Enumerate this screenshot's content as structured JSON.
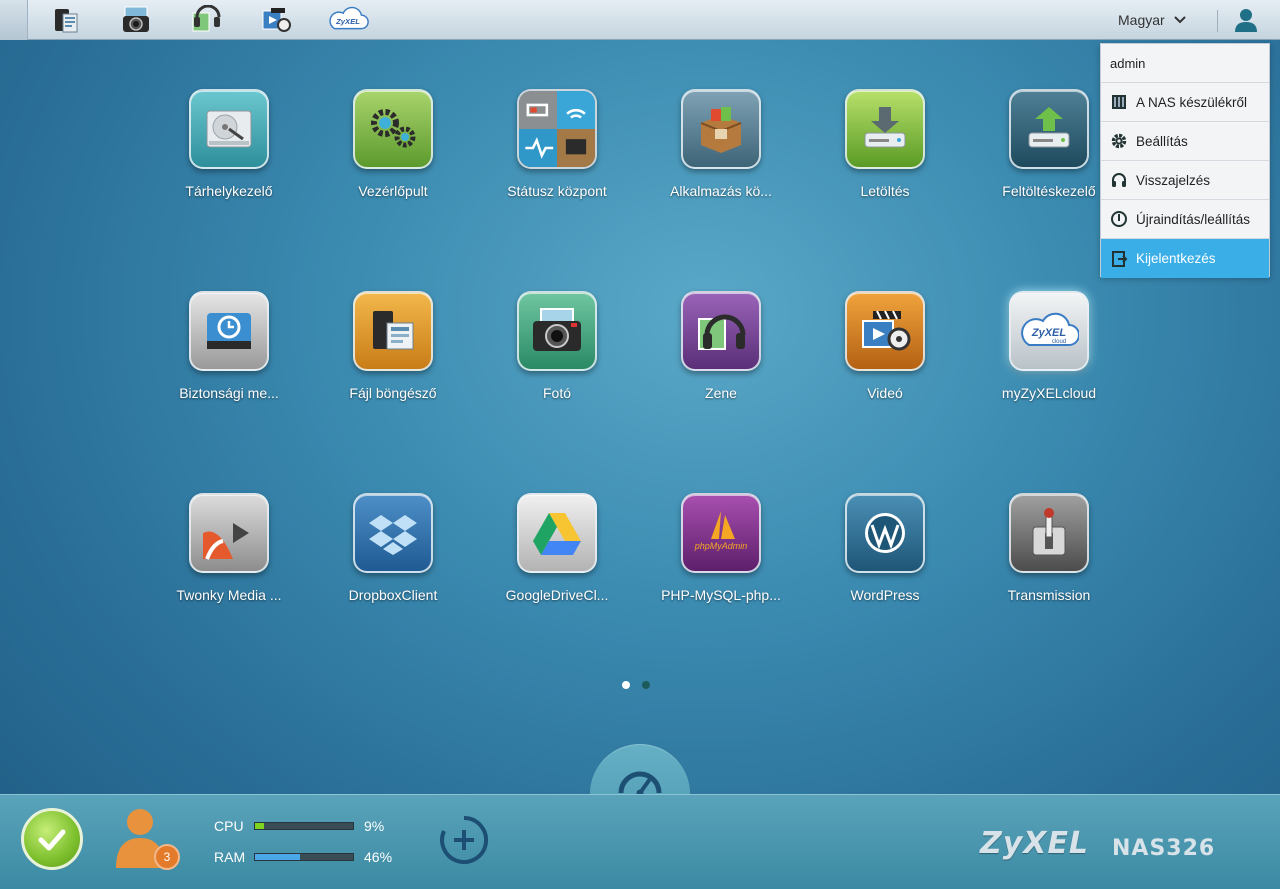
{
  "topbar": {
    "shortcuts": [
      {
        "name": "file-browser-shortcut-icon"
      },
      {
        "name": "photo-shortcut-icon"
      },
      {
        "name": "music-shortcut-icon"
      },
      {
        "name": "video-shortcut-icon"
      },
      {
        "name": "zyxel-cloud-shortcut-icon",
        "text": "ZyXEL"
      }
    ],
    "language": "Magyar",
    "user_icon": "user-icon"
  },
  "user_menu": {
    "username": "admin",
    "items": [
      {
        "label": "A NAS készülékről",
        "icon": "info-device-icon"
      },
      {
        "label": "Beállítás",
        "icon": "gear-icon"
      },
      {
        "label": "Visszajelzés",
        "icon": "headset-icon"
      },
      {
        "label": "Újraindítás/leállítás",
        "icon": "power-icon"
      },
      {
        "label": "Kijelentkezés",
        "icon": "logout-icon",
        "active": true
      }
    ]
  },
  "apps": [
    {
      "label": "Tárhelykezelő"
    },
    {
      "label": "Vezérlőpult"
    },
    {
      "label": "Státusz központ"
    },
    {
      "label": "Alkalmazás kö..."
    },
    {
      "label": "Letöltés"
    },
    {
      "label": "Feltöltéskezelő"
    },
    {
      "label": "Biztonsági me..."
    },
    {
      "label": "Fájl böngésző"
    },
    {
      "label": "Fotó"
    },
    {
      "label": "Zene"
    },
    {
      "label": "Videó"
    },
    {
      "label": "myZyXELcloud",
      "badge_text": "ZyXEL",
      "badge_sub": "cloud"
    },
    {
      "label": "Twonky Media ..."
    },
    {
      "label": "DropboxClient"
    },
    {
      "label": "GoogleDriveCl..."
    },
    {
      "label": "PHP-MySQL-php...",
      "badge_text": "phpMyAdmin"
    },
    {
      "label": "WordPress"
    },
    {
      "label": "Transmission"
    }
  ],
  "pager": {
    "current": 1,
    "total": 2
  },
  "bottombar": {
    "user_count": "3",
    "cpu": {
      "label": "CPU",
      "value": "9%",
      "percent": 9,
      "color": "#7ed321"
    },
    "ram": {
      "label": "RAM",
      "value": "46%",
      "percent": 46,
      "color": "#4aa8e8"
    },
    "brand": "ZyXEL",
    "model": "NAS326"
  }
}
